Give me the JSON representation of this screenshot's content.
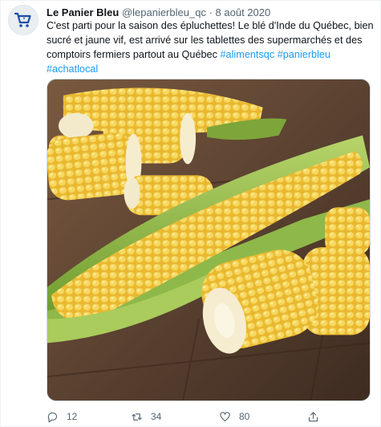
{
  "tweet": {
    "author_name": "Le Panier Bleu",
    "handle": "@lepanierbleu_qc",
    "separator": "·",
    "date": "8 août 2020",
    "text_body": "C'est parti pour la saison des épluchettes! Le blé d'Inde du Québec, bien sucré et jaune vif, est arrivé sur les tablettes des supermarchés et des comptoirs fermiers partout au Québec",
    "hashtags": [
      "#alimentsqc",
      "#panierbleu",
      "#achatlocal"
    ],
    "media": {
      "icon": "corn-photo"
    },
    "stats": {
      "replies": "12",
      "retweets": "34",
      "likes": "80"
    }
  },
  "colors": {
    "brand_blue": "#1e4fa0",
    "link": "#1d9bf0",
    "muted": "#536471"
  },
  "icons": [
    "shopping-cart-icon",
    "reply-icon",
    "retweet-icon",
    "like-icon",
    "share-icon"
  ]
}
